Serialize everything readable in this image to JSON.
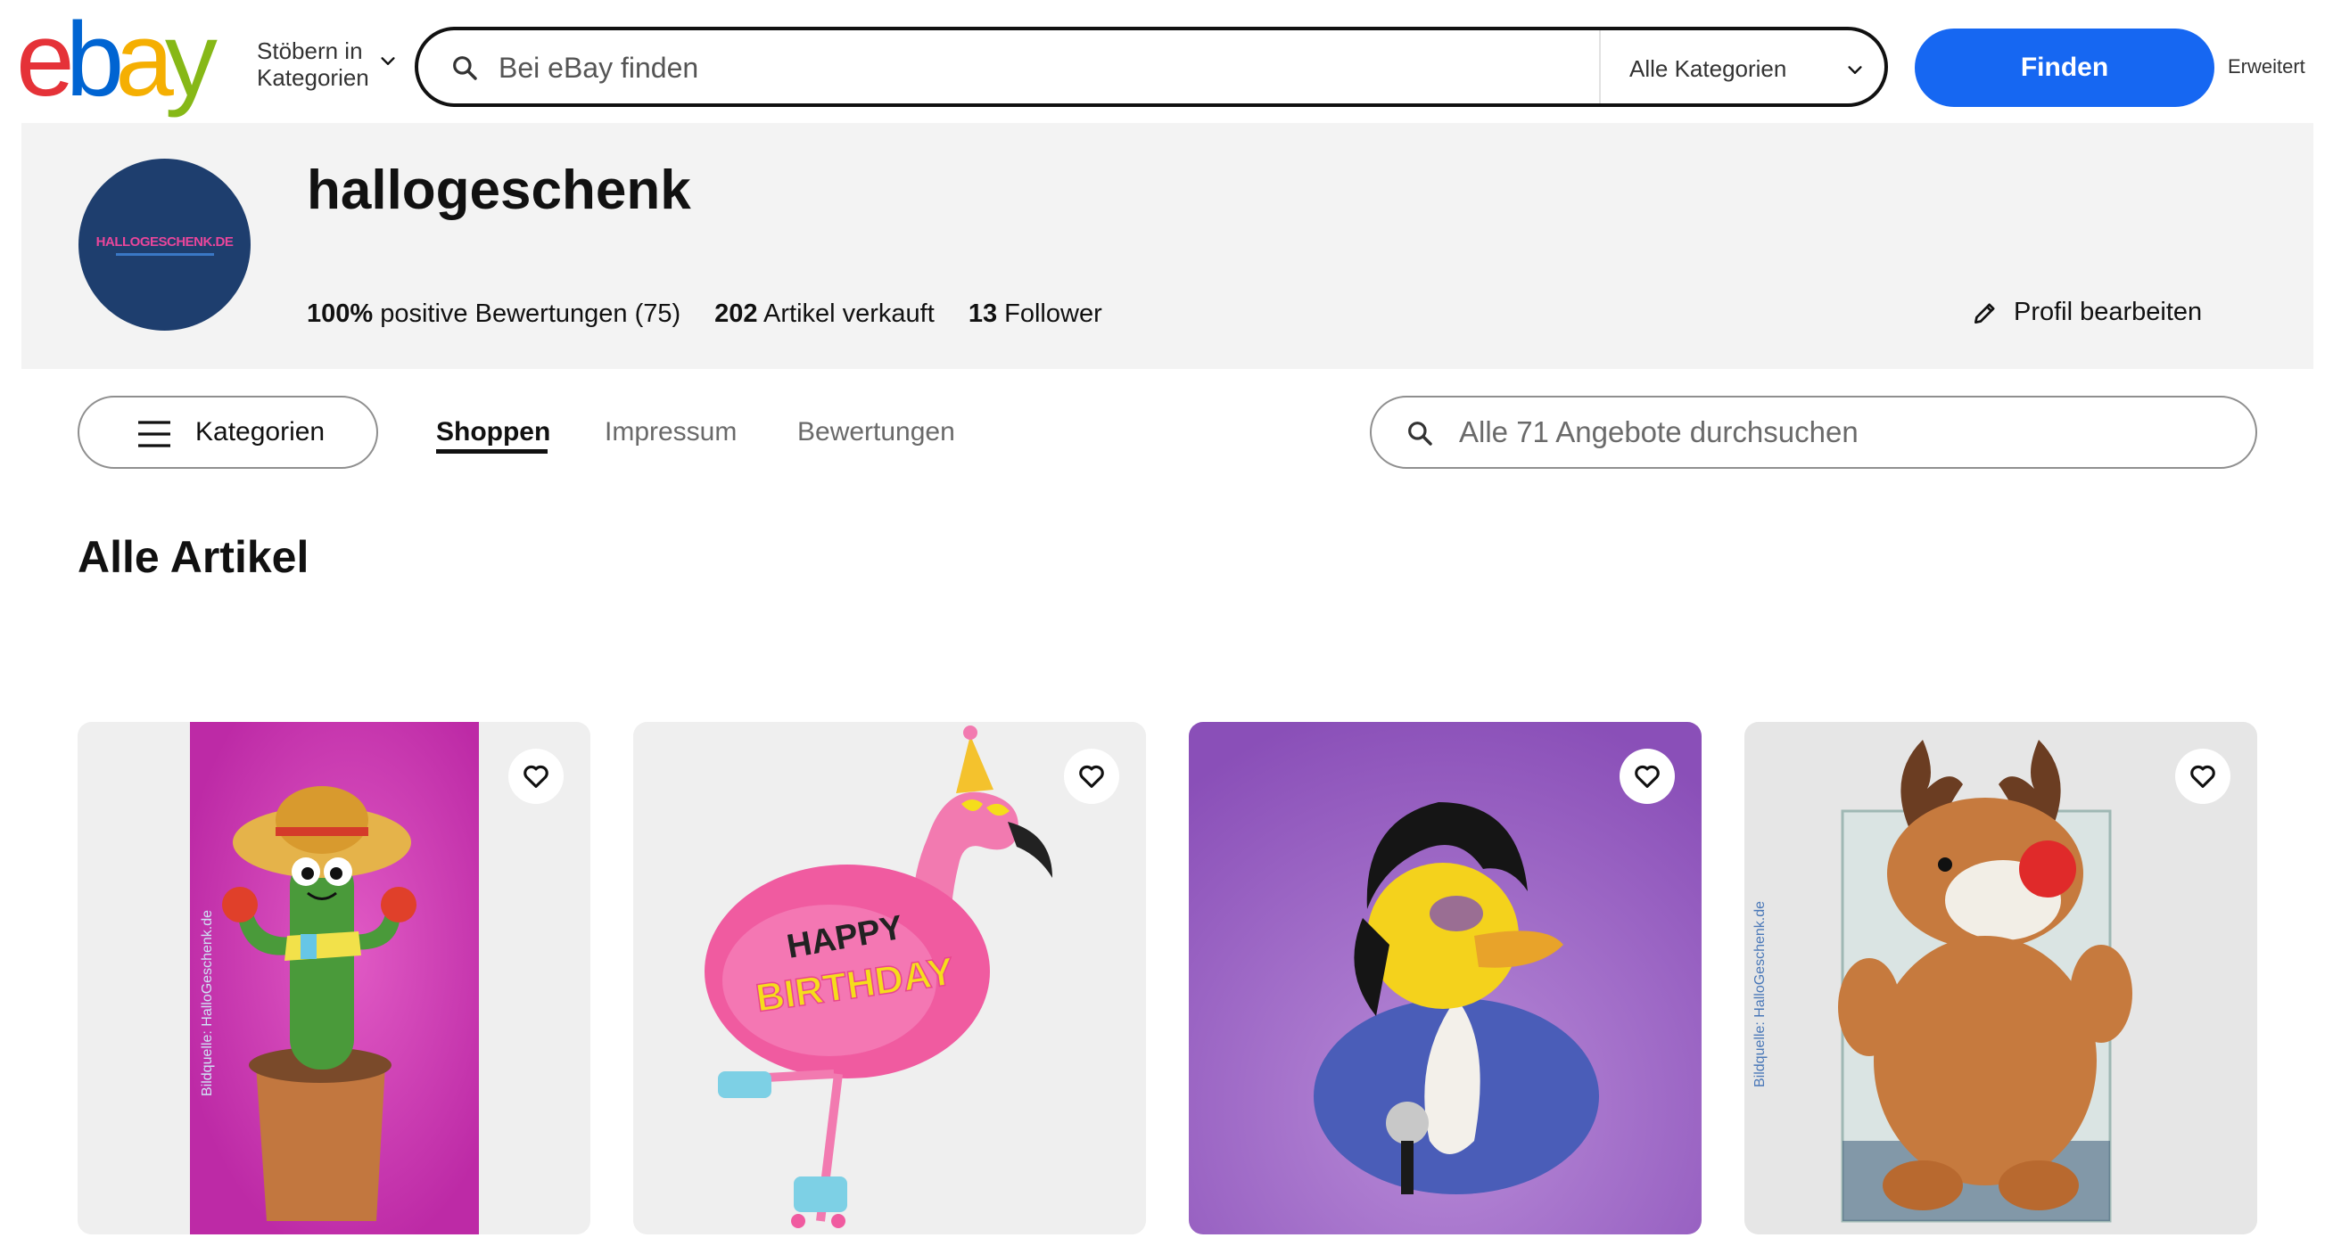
{
  "header": {
    "logo": {
      "letters": [
        "e",
        "b",
        "a",
        "y"
      ],
      "colors": [
        "#e53238",
        "#0064d2",
        "#f5af02",
        "#86b817"
      ]
    },
    "browse_label_line1": "Stöbern in",
    "browse_label_line2": "Kategorien",
    "search_placeholder": "Bei eBay finden",
    "category_select": "Alle Kategorien",
    "find_button": "Finden",
    "advanced_link": "Erweitert",
    "accent_color": "#1667f2"
  },
  "store": {
    "name": "hallogeschenk",
    "avatar_text": "HALLOGESCHENK.DE",
    "stats": {
      "positive_pct": "100%",
      "positive_label": "positive Bewertungen (75)",
      "sold_count": "202",
      "sold_label": "Artikel verkauft",
      "followers_count": "13",
      "followers_label": "Follower"
    },
    "edit_profile": "Profil bearbeiten"
  },
  "nav": {
    "categories_button": "Kategorien",
    "tabs": [
      {
        "label": "Shoppen",
        "active": true
      },
      {
        "label": "Impressum",
        "active": false
      },
      {
        "label": "Bewertungen",
        "active": false
      }
    ],
    "store_search_placeholder": "Alle 71 Angebote durchsuchen"
  },
  "main": {
    "section_title": "Alle Artikel",
    "products": [
      {
        "image": "dancing-cactus-plush",
        "favorite_icon": "heart-icon"
      },
      {
        "image": "flamingo-happy-birthday-balloon",
        "favorite_icon": "heart-icon"
      },
      {
        "image": "rubber-duck-figure",
        "favorite_icon": "heart-icon"
      },
      {
        "image": "reindeer-plush-in-box",
        "favorite_icon": "heart-icon"
      }
    ]
  }
}
